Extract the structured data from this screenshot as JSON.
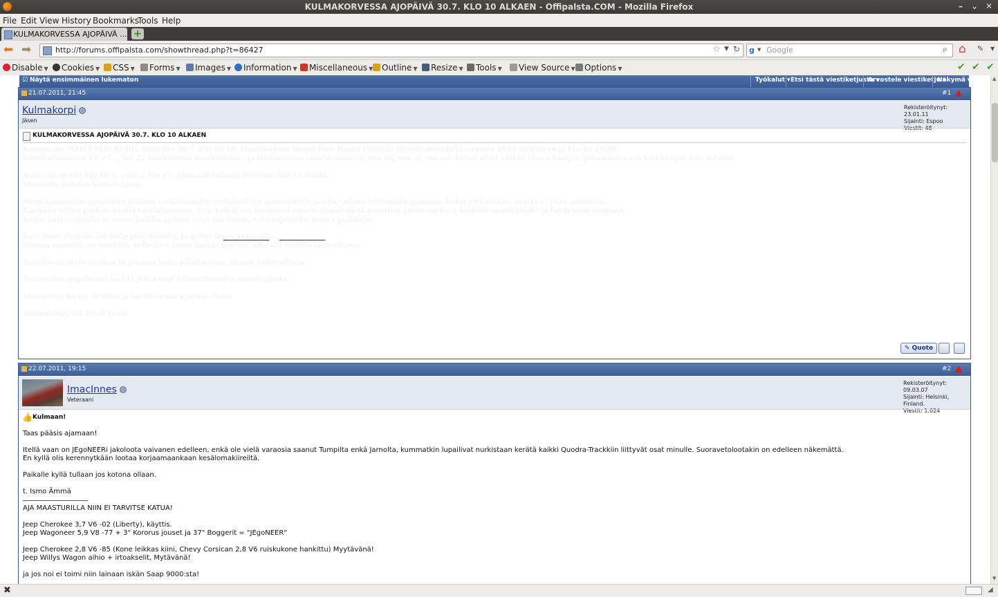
{
  "window": {
    "title": "KULMAKORVESSA AJOPÄIVÄ 30.7. KLO 10 ALKAEN - Offipalsta.COM - Mozilla Firefox"
  },
  "menu": [
    "File",
    "Edit",
    "View",
    "History",
    "Bookmarks",
    "Tools",
    "Help"
  ],
  "tab": {
    "label": "KULMAKORVESSA AJOPÄIVÄ ..."
  },
  "nav": {
    "url": "http://forums.offipalsta.com/showthread.php?t=86427",
    "search_placeholder": "Google"
  },
  "devbar": [
    "Disable",
    "Cookies",
    "CSS",
    "Forms",
    "Images",
    "Information",
    "Miscellaneous",
    "Outline",
    "Resize",
    "Tools",
    "View Source",
    "Options"
  ],
  "thread_tools": {
    "first_unread": "Näytä ensimmäinen lukematon",
    "buttons": [
      "Työkalut",
      "Etsi tästä viestiketjusta",
      "Arvostele viestiketju",
      "Näkymä"
    ]
  },
  "posts": [
    {
      "date": "21.07.2011, 21:45",
      "number": "#1",
      "username": "Kulmakorpi",
      "role": "Jäsen",
      "info": [
        "Rekisteröitynyt: 23.01.11",
        "Sijainti: Espoo",
        "Viestit: 48"
      ],
      "title": "KULMAKORVESSA AJOPÄIVÄ 30.7. KLO 10 ALKAEN",
      "hidden_lines": [
        "Kangasala, ORIVESI ja KURU. Kuntalla 30.7. klo 10-20. Maastoajoon tuomi Kesi Tuomi (TMKS) Maastoajoradalla vuosien 2011 ajopäivän ja klo 10-20:00",
        "Kuudenhuoneen FE 27..., tai 22 muunnossä maskitilanne ja tilaisuuteen suurta suomea, osa oli, osa ei, osa on. ketkä eivät kaikki tunne kävijät, pihamaalla saa kaikki ajaa 100 asiasta",
        "Auki ollaan siis klo 10 ja päätyy klo 17, ajamaan tullaan syötyään klo 12 illalla.",
        "Mennään kahden kesken vaan.",
        "Pieni kunnostus ajopäivän jälkeen tarkistamalla metsäreitille ajoneuvoille ja olla valmis lähtemään ajamaan kohti sitä päivää, mutta ei liian myöhään.",
        "Käydään sitten paikan päällä tarkistamassa, että kaikki on kunnossa ennen ajopäivää ja maaston kunto on hyvä kaikille osallistujille ja lähdetään ajamaan.",
        "Katso kartta sivulta ja varaa paikka ajoissa ettei jää ilman, vain rajoitettu määrä paikkoja.",
        "Kysy lisää viestillä tai soita puhelimella, ja kerro myös kavereille.",
        "Alueen ajoreitit on merkitty selkeästi, joten kaikki pysyvät oikealla reitillä ajon aikana.",
        "Tarjolla on myös ruokaa ja juomaa koko päivän ajan, hinnat kohtuullisia.",
        "Tervetuloa ajopäivään kaikki jotka ovat kiinnostuneita maastoajosta.",
        "Lisätietoja löytyy sivuilta ja tarvittaessa kysykää lisää.",
        "Kulmakorpi Off Road Team"
      ]
    },
    {
      "date": "22.07.2011, 19:15",
      "number": "#2",
      "username": "ImacInnes",
      "role": "Veteraani",
      "info": [
        "Rekisteröitynyt: 09.03.07",
        "Sijainti: Helsinki, Finland.",
        "Viestit: 1.024"
      ],
      "title": "Kulmaan!",
      "lines": [
        "Taas pääsis ajamaan!",
        "Itellä vaan on JEgoNEERi jakoloota vaivanen edelleen, enkä ole vielä varaosia saanut Tumpilta enkä Jarnolta, kummatkin lupailivat nurkistaan kerätä kaikki Quodra-Trackkiin liittyvät osat minulle. Suoravetolootakin on edelleen näkemättä.",
        "En kyllä olis kerennytkään lootaa korjaamaankaan kesälomakiireiltä.",
        "Paikalle kyllä tullaan jos kotona ollaan.",
        "t. Ismo Ämmä",
        "AJA MAASTURILLA NIIN EI TARVITSE KATUA!",
        "Jeep Cherokee 3,7 V6 -02 (Liberty), käyttis.",
        "Jeep Wagoneer 5,9 V8 -77 + 3\" Kororus jouset ja 37\" Boggerit = \"JEgoNEER\"",
        "Jeep Cherokee 2,8 V6 -85 (Kone leikkas kiini, Chevy Corsican 2,8 V6 ruiskukone hankittu) Myytävänä!",
        "Jeep Willys Wagon aihio + irtoakselit, Mytävänä!",
        "ja jos noi ei toimi niin lainaan iskän Saap 9000:sta!"
      ]
    }
  ],
  "quote_label": "Quote",
  "colors": {
    "forum_blue": "#3a5a92",
    "user_bg": "#e4e8f1",
    "username": "#1a3a9a"
  }
}
